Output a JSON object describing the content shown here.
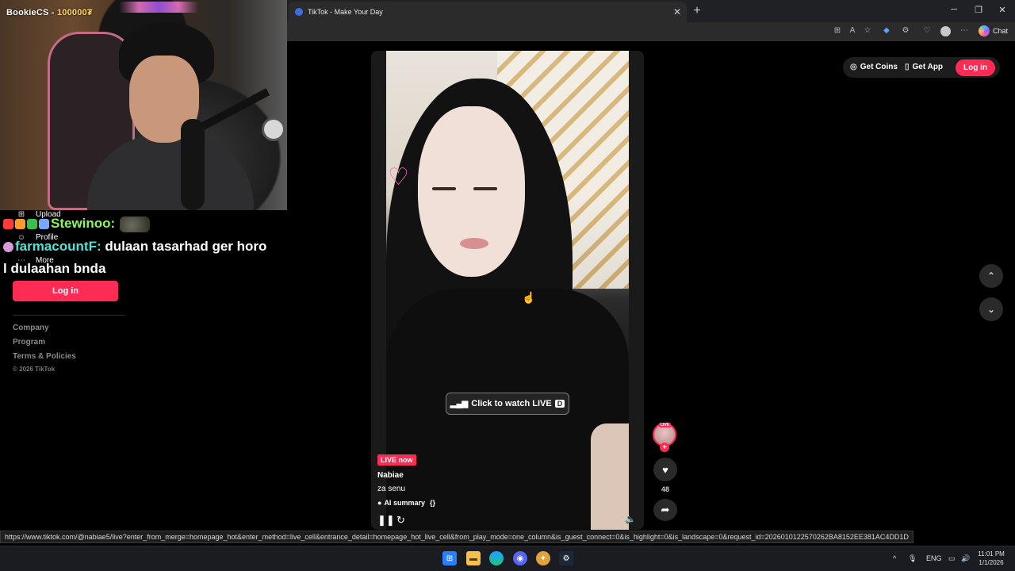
{
  "browser": {
    "tab_title": "TikTok - Make Your Day",
    "tab_close": "✕",
    "new_tab": "+",
    "minimize": "─",
    "restore": "❐",
    "close": "✕",
    "chat_label": "Chat"
  },
  "stream": {
    "title_name": "BookieCS - ",
    "title_amount": "100000₮"
  },
  "sidebar": {
    "items": [
      {
        "label": "Upload",
        "icon": "upload-icon",
        "glyph": "⊞"
      },
      {
        "label": "Profile",
        "icon": "profile-icon",
        "glyph": "☺"
      },
      {
        "label": "More",
        "icon": "more-icon",
        "glyph": "⋯"
      }
    ],
    "login_label": "Log in",
    "links": [
      "Company",
      "Program",
      "Terms & Policies"
    ],
    "copyright": "© 2026 TikTok"
  },
  "chat": {
    "messages": [
      {
        "user": "Stewinoo:",
        "text": ""
      },
      {
        "user": "farmacountF:",
        "text": " dulaan tasarhad ger horo"
      },
      {
        "user": "",
        "text": "l dulaahan bnda"
      }
    ]
  },
  "header": {
    "get_coins": "Get Coins",
    "get_app": "Get App",
    "login_label": "Log in"
  },
  "nav": {
    "up": "⌃",
    "down": "⌄"
  },
  "video": {
    "watch_live_label": "Click to watch LIVE",
    "watch_live_key": "D",
    "live_badge": "LIVE now",
    "username": "Nabiae",
    "description": "za senu",
    "ai_summary_label": "AI summary",
    "ai_summary_braces": "{}",
    "pause_glyph": "❚❚",
    "refresh_glyph": "↻",
    "volume_glyph": "🔈"
  },
  "actions": {
    "avatar_live_tag": "LIVE",
    "follow_glyph": "+",
    "like_glyph": "♥",
    "like_count": "48",
    "share_glyph": "➦"
  },
  "status_url": "https://www.tiktok.com/@nabiae5/live?enter_from_merge=homepage_hot&enter_method=live_cell&entrance_detail=homepage_hot_live_cell&from_play_mode=one_column&is_guest_connect=0&is_highlight=0&is_landscape=0&request_id=20260101225702​62BA8152EE381AC4DD1D",
  "taskbar": {
    "tray_up": "^",
    "language": "ENG",
    "time": "11:01 PM",
    "date": "1/1/2026"
  },
  "colors": {
    "accent": "#fe2c55"
  }
}
